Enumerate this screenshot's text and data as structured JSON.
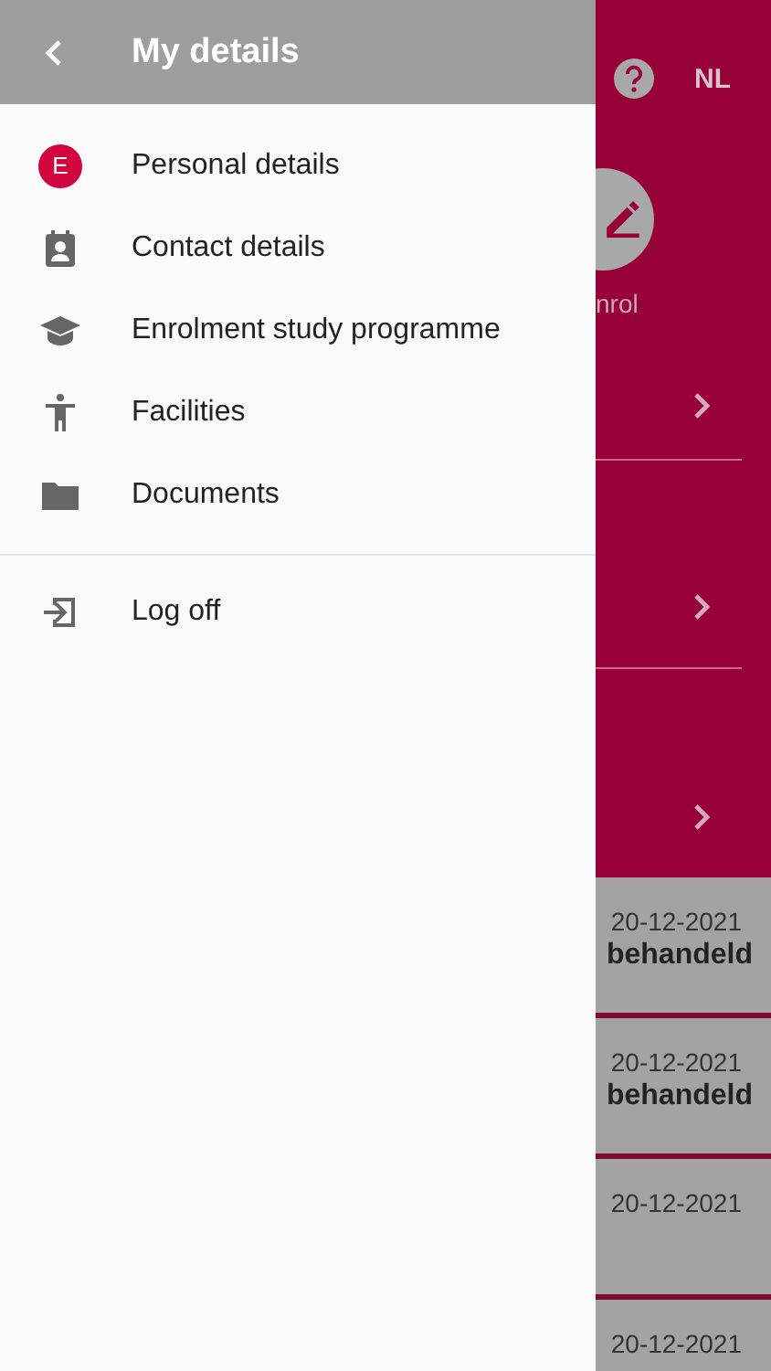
{
  "drawer": {
    "title": "My details",
    "items": [
      {
        "kind": "avatar",
        "avatar_letter": "E",
        "label": "Personal details"
      },
      {
        "kind": "contact",
        "label": "Contact details"
      },
      {
        "kind": "school",
        "label": "Enrolment study programme"
      },
      {
        "kind": "accessibility",
        "label": "Facilities"
      },
      {
        "kind": "folder",
        "label": "Documents"
      }
    ],
    "footer_items": [
      {
        "kind": "logout",
        "label": "Log off"
      }
    ]
  },
  "background": {
    "language": "NL",
    "action_label": "nrol",
    "cards": [
      {
        "date": "20-12-2021",
        "status": "behandeld"
      },
      {
        "date": "20-12-2021",
        "status": "behandeld"
      },
      {
        "date": "20-12-2021"
      },
      {
        "date": "20-12-2021"
      }
    ]
  }
}
